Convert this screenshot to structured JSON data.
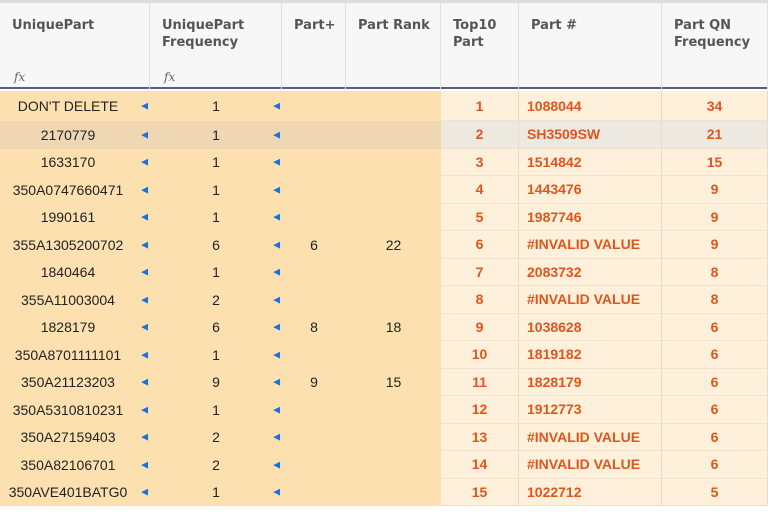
{
  "columns": [
    {
      "label": "UniquePart",
      "formula": "fx"
    },
    {
      "label": "UniquePart Frequency",
      "formula": "fx"
    },
    {
      "label": "Part+"
    },
    {
      "label": "Part Rank"
    },
    {
      "label": "Top10 Part"
    },
    {
      "label": "Part #"
    },
    {
      "label": "Part QN Frequency"
    }
  ],
  "selected_row": 1,
  "rows": [
    [
      "DON'T DELETE",
      "1",
      "",
      "",
      "1",
      "1088044",
      "34"
    ],
    [
      "2170779",
      "1",
      "",
      "",
      "2",
      "SH3509SW",
      "21"
    ],
    [
      "1633170",
      "1",
      "",
      "",
      "3",
      "1514842",
      "15"
    ],
    [
      "350A0747660471",
      "1",
      "",
      "",
      "4",
      "1443476",
      "9"
    ],
    [
      "1990161",
      "1",
      "",
      "",
      "5",
      "1987746",
      "9"
    ],
    [
      "355A1305200702",
      "6",
      "6",
      "22",
      "6",
      "#INVALID VALUE",
      "9"
    ],
    [
      "1840464",
      "1",
      "",
      "",
      "7",
      "2083732",
      "8"
    ],
    [
      "355A11003004",
      "2",
      "",
      "",
      "8",
      "#INVALID VALUE",
      "8"
    ],
    [
      "1828179",
      "6",
      "8",
      "18",
      "9",
      "1038628",
      "6"
    ],
    [
      "350A8701111101",
      "1",
      "",
      "",
      "10",
      "1819182",
      "6"
    ],
    [
      "350A21123203",
      "9",
      "9",
      "15",
      "11",
      "1828179",
      "6"
    ],
    [
      "350A5310810231",
      "1",
      "",
      "",
      "12",
      "1912773",
      "6"
    ],
    [
      "350A27159403",
      "2",
      "",
      "",
      "13",
      "#INVALID VALUE",
      "6"
    ],
    [
      "350A82106701",
      "2",
      "",
      "",
      "14",
      "#INVALID VALUE",
      "6"
    ],
    [
      "350AVE401BATG0",
      "1",
      "",
      "",
      "15",
      "1022712",
      "5"
    ]
  ],
  "colors": {
    "accent_text": "#e0561a",
    "left_bg": "#fde0b0",
    "right_bg": "#fff0dc",
    "arrow": "#1a73d9"
  }
}
